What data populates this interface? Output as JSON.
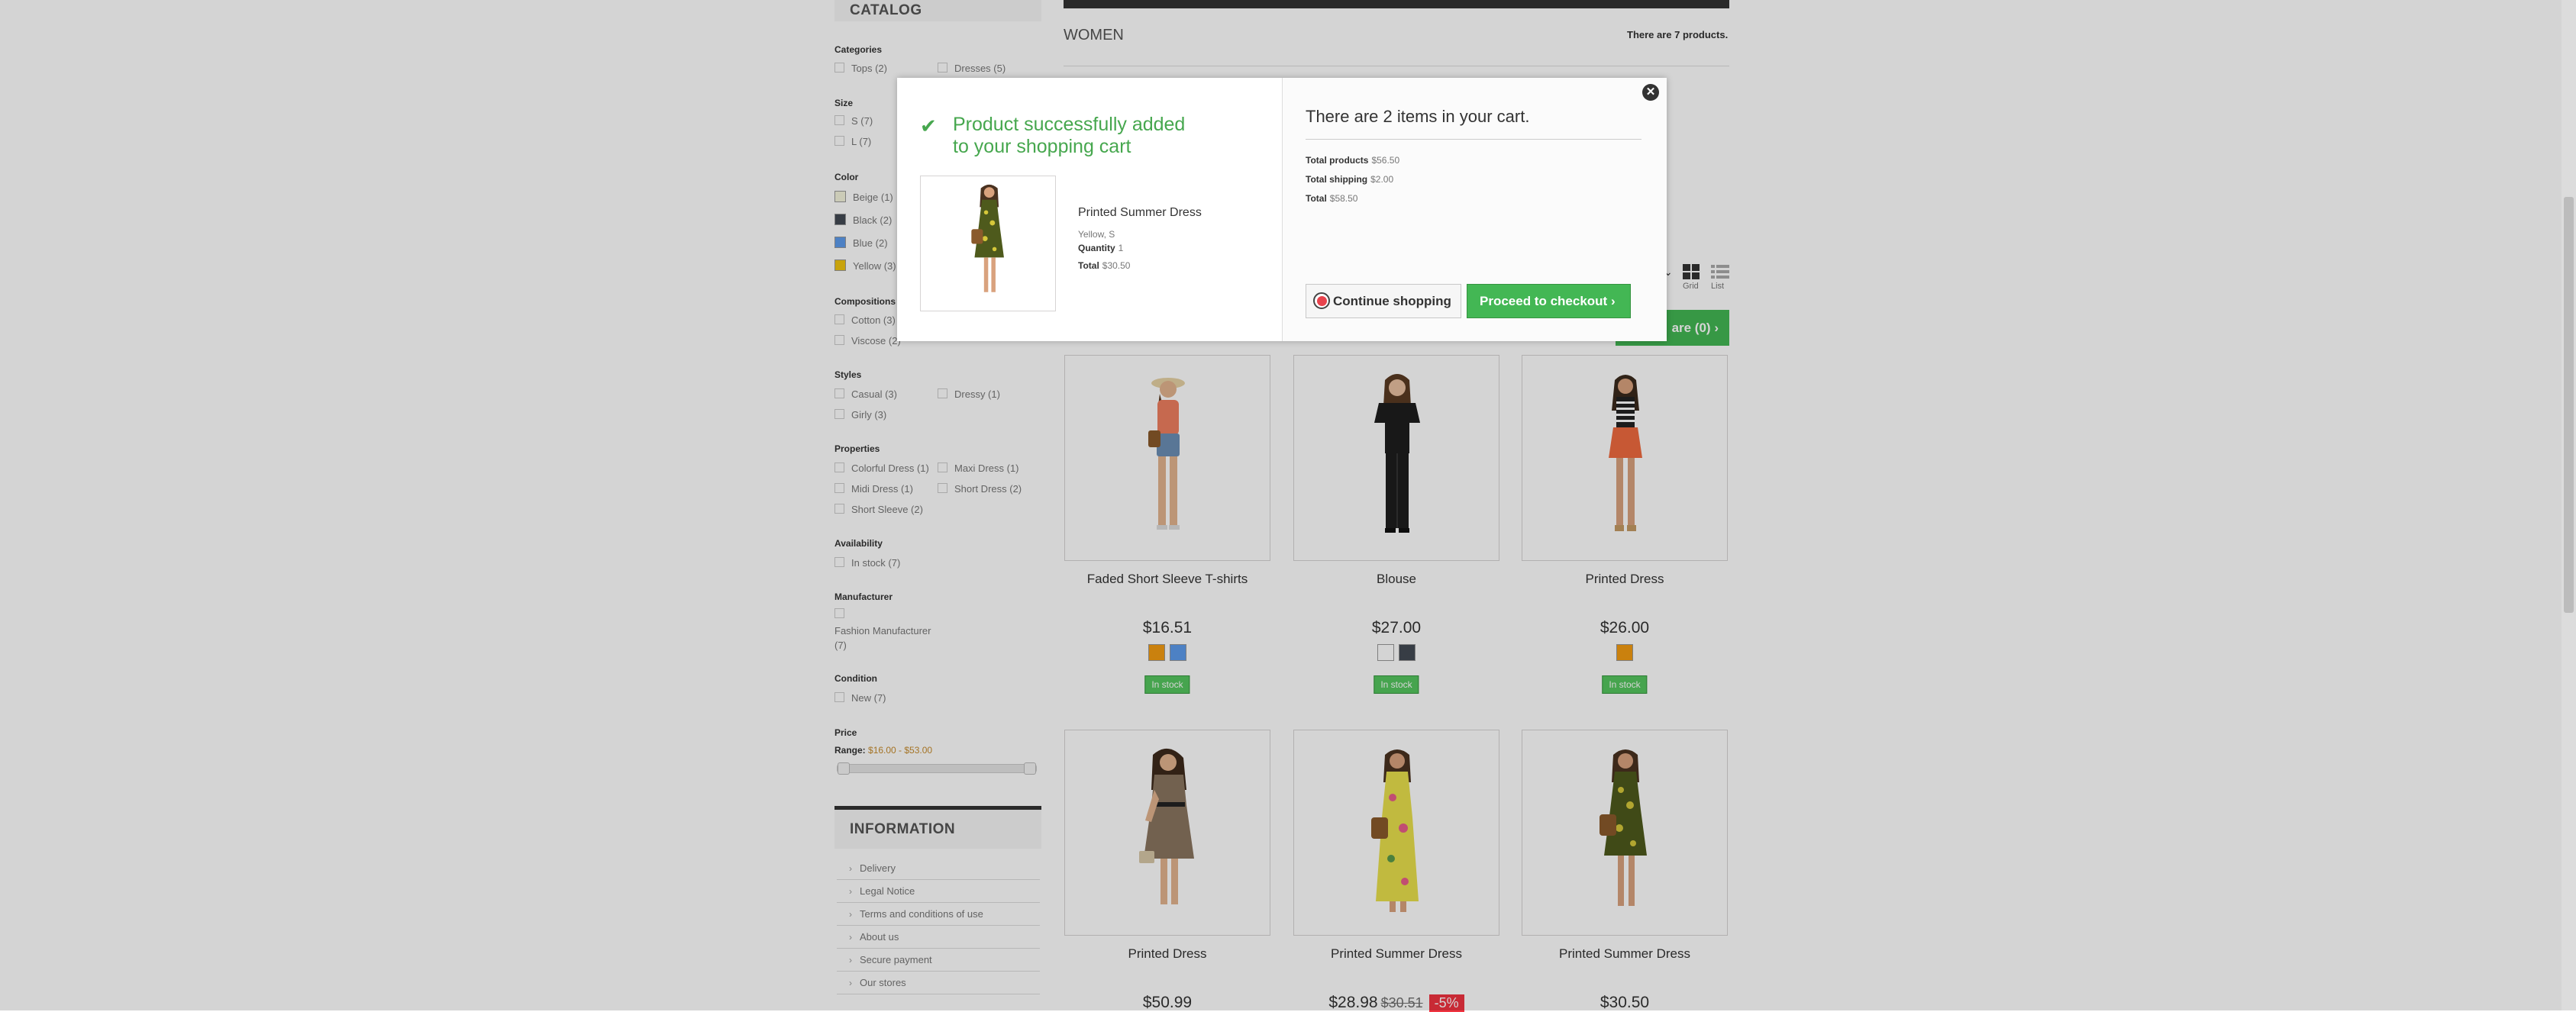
{
  "sidebar": {
    "catalog_title": "CATALOG",
    "groups": {
      "categories": {
        "title": "Categories",
        "items": [
          "Tops (2)",
          "Dresses (5)"
        ]
      },
      "size": {
        "title": "Size",
        "items": [
          "S (7)",
          "L (7)"
        ]
      },
      "color": {
        "title": "Color",
        "items": [
          {
            "label": "Beige (1)",
            "color": "#f5f5dc"
          },
          {
            "label": "Black (2)",
            "color": "#434a54"
          },
          {
            "label": "Blue (2)",
            "color": "#5d9cec"
          },
          {
            "label": "Yellow (3)",
            "color": "#f1c40f"
          }
        ]
      },
      "compositions": {
        "title": "Compositions",
        "items": [
          "Cotton (3)",
          "Viscose (2)"
        ]
      },
      "styles": {
        "title": "Styles",
        "items": [
          "Casual (3)",
          "Dressy (1)",
          "Girly (3)"
        ]
      },
      "properties": {
        "title": "Properties",
        "items": [
          "Colorful Dress (1)",
          "Maxi Dress (1)",
          "Midi Dress (1)",
          "Short Dress (2)",
          "Short Sleeve (2)"
        ]
      },
      "availability": {
        "title": "Availability",
        "items": [
          "In stock (7)"
        ]
      },
      "manufacturer": {
        "title": "Manufacturer",
        "items": [
          "Fashion Manufacturer",
          "(7)"
        ]
      },
      "condition": {
        "title": "Condition",
        "items": [
          "New (7)"
        ]
      },
      "price": {
        "title": "Price",
        "range_label": "Range:",
        "range_value": "$16.00 - $53.00"
      }
    },
    "information": {
      "title": "INFORMATION",
      "items": [
        "Delivery",
        "Legal Notice",
        "Terms and conditions of use",
        "About us",
        "Secure payment",
        "Our stores"
      ]
    }
  },
  "main": {
    "category_title": "WOMEN",
    "product_count": "There are 7 products.",
    "view": {
      "grid": "Grid",
      "list": "List"
    },
    "compare": "are (0)",
    "products": [
      {
        "name": "Faded Short Sleeve T-shirts",
        "price": "$16.51",
        "swatches": [
          "#f39c11",
          "#5d9cec"
        ],
        "stock": "In stock"
      },
      {
        "name": "Blouse",
        "price": "$27.00",
        "swatches": [
          "#ffffff",
          "#434a54"
        ],
        "stock": "In stock"
      },
      {
        "name": "Printed Dress",
        "price": "$26.00",
        "swatches": [
          "#f39c11"
        ],
        "stock": "In stock"
      },
      {
        "name": "Printed Dress",
        "price": "$50.99"
      },
      {
        "name": "Printed Summer Dress",
        "price": "$28.98",
        "old_price": "$30.51",
        "discount": "-5%"
      },
      {
        "name": "Printed Summer Dress",
        "price": "$30.50"
      }
    ]
  },
  "modal": {
    "success_title": "Product successfully added to your shopping cart",
    "product": {
      "name": "Printed Summer Dress",
      "attributes": "Yellow, S",
      "quantity_label": "Quantity",
      "quantity": "1",
      "total_label": "Total",
      "total": "$30.50"
    },
    "cart_heading": "There are 2 items in your cart.",
    "totals": {
      "products_label": "Total products",
      "products": "$56.50",
      "shipping_label": "Total shipping",
      "shipping": "$2.00",
      "total_label": "Total",
      "total": "$58.50"
    },
    "continue_label": "Continue shopping",
    "checkout_label": "Proceed to checkout"
  }
}
